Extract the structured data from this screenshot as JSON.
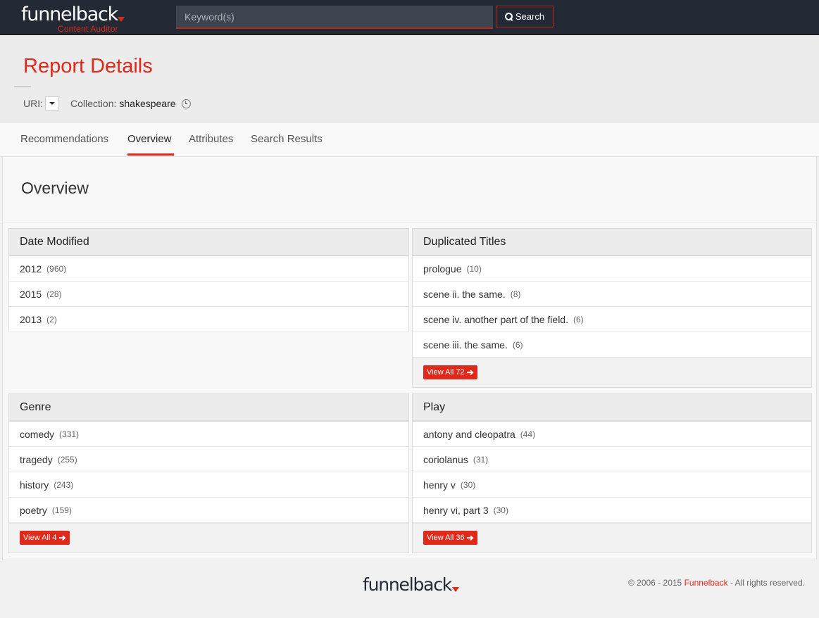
{
  "navbar": {
    "logo_text": "funnelback",
    "logo_subtitle": "Content Auditor",
    "search_placeholder": "Keyword(s)",
    "search_button_label": "Search"
  },
  "header": {
    "title": "Report Details",
    "uri_label": "URI:",
    "collection_label": "Collection:",
    "collection_value": "shakespeare"
  },
  "tabs": [
    {
      "label": "Recommendations",
      "active": false
    },
    {
      "label": "Overview",
      "active": true
    },
    {
      "label": "Attributes",
      "active": false
    },
    {
      "label": "Search Results",
      "active": false
    }
  ],
  "main": {
    "title": "Overview",
    "panels": {
      "date_modified": {
        "title": "Date Modified",
        "items": [
          {
            "label": "2012",
            "count": "(960)"
          },
          {
            "label": "2015",
            "count": "(28)"
          },
          {
            "label": "2013",
            "count": "(2)"
          }
        ]
      },
      "duplicated_titles": {
        "title": "Duplicated Titles",
        "items": [
          {
            "label": "prologue",
            "count": "(10)"
          },
          {
            "label": "scene ii. the same.",
            "count": "(8)"
          },
          {
            "label": "scene iv. another part of the field.",
            "count": "(6)"
          },
          {
            "label": "scene iii. the same.",
            "count": "(6)"
          }
        ],
        "view_all": "View All 72"
      },
      "genre": {
        "title": "Genre",
        "items": [
          {
            "label": "comedy",
            "count": "(331)"
          },
          {
            "label": "tragedy",
            "count": "(255)"
          },
          {
            "label": "history",
            "count": "(243)"
          },
          {
            "label": "poetry",
            "count": "(159)"
          }
        ],
        "view_all": "View All 4"
      },
      "play": {
        "title": "Play",
        "items": [
          {
            "label": "antony and cleopatra",
            "count": "(44)"
          },
          {
            "label": "coriolanus",
            "count": "(31)"
          },
          {
            "label": "henry v",
            "count": "(30)"
          },
          {
            "label": "henry vi, part 3",
            "count": "(30)"
          }
        ],
        "view_all": "View All 36"
      }
    }
  },
  "footer": {
    "logo_text": "funnelback",
    "copyright_prefix": "© 2006 - 2015",
    "copyright_brand": "Funnelback",
    "copyright_suffix": "- All rights reserved."
  },
  "colors": {
    "accent": "#e0291a",
    "navbar": "#232a36"
  }
}
